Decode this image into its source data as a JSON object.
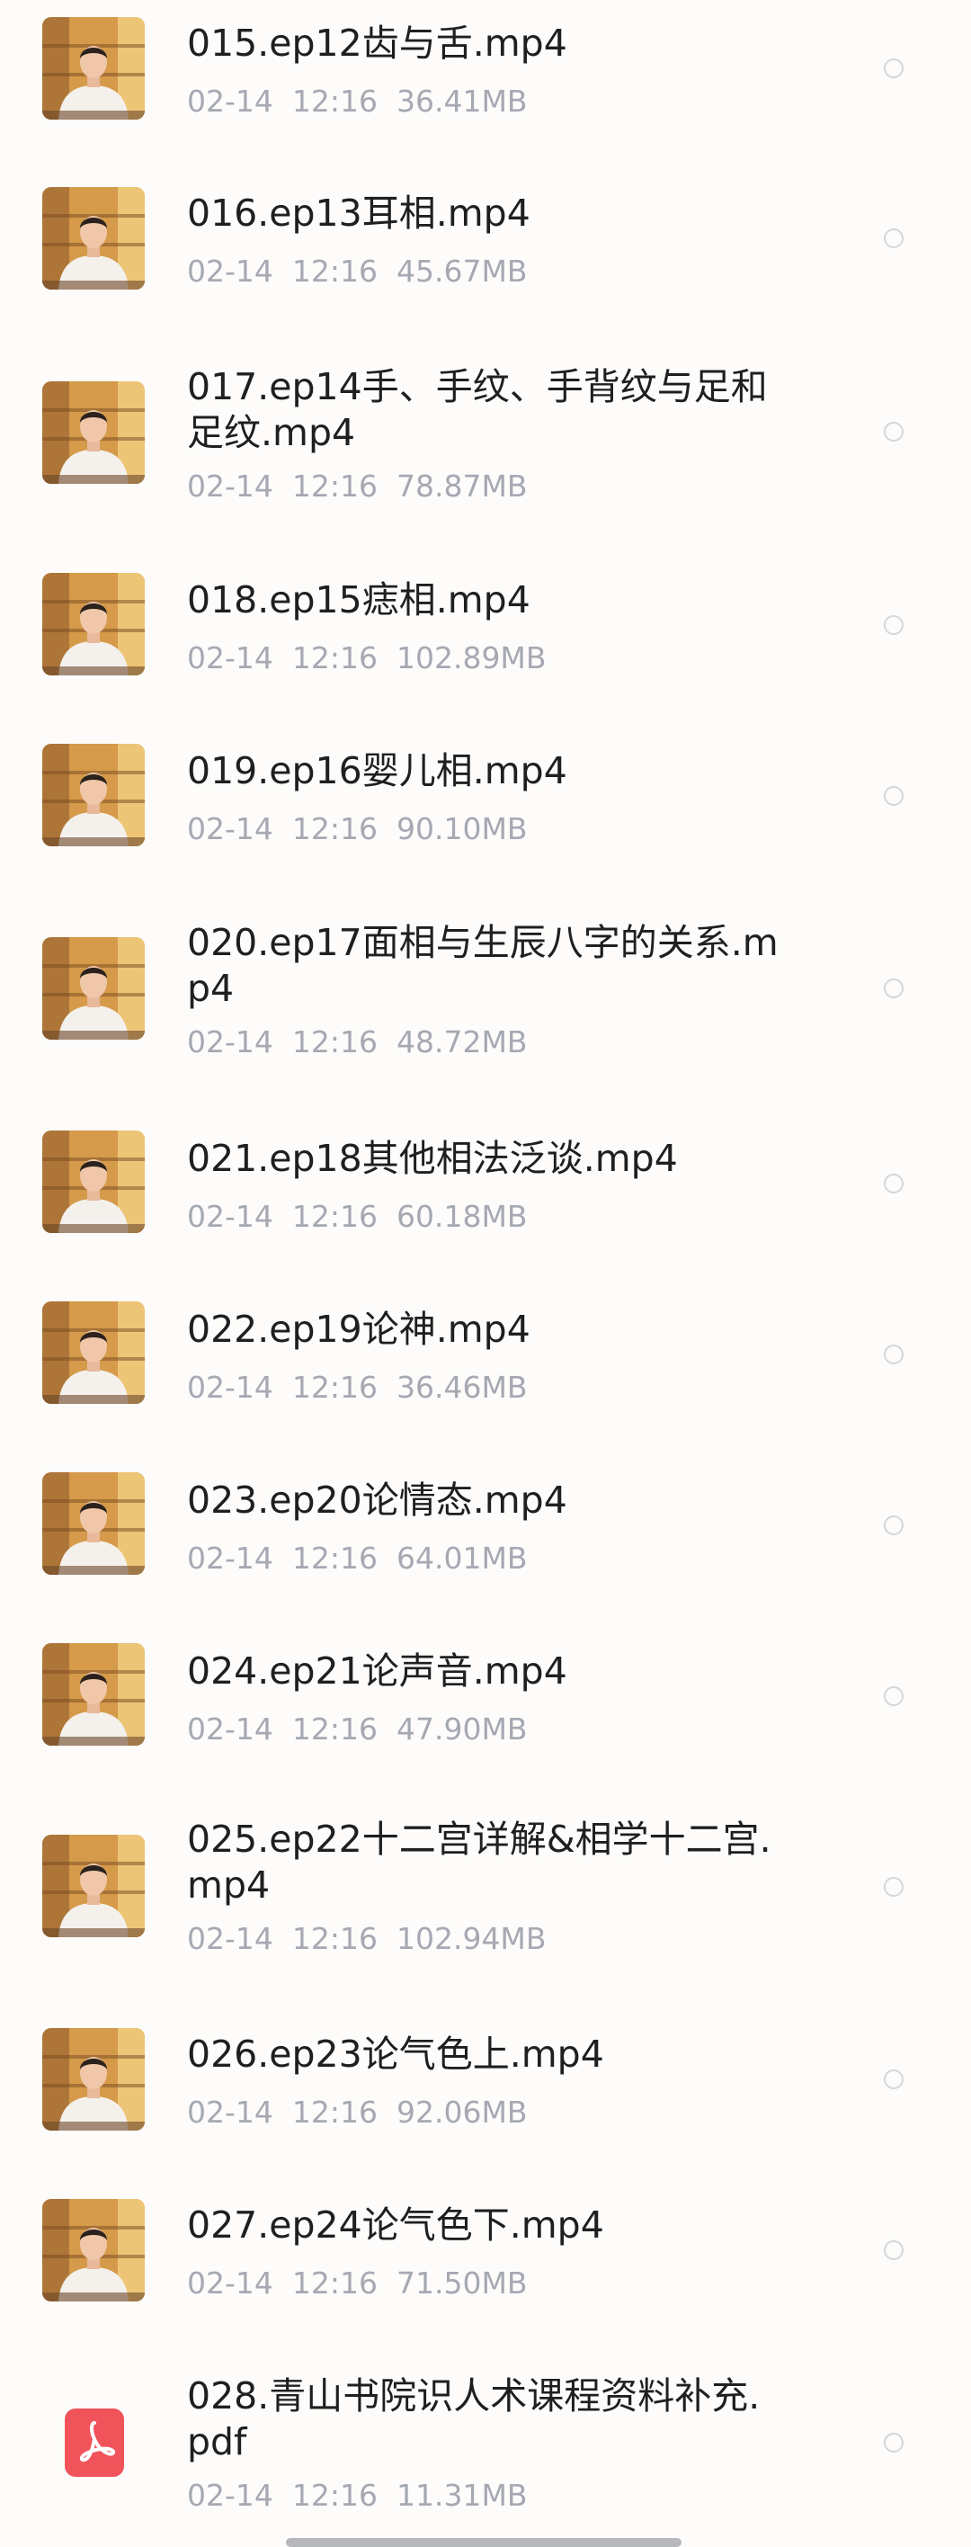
{
  "files": [
    {
      "name": "015.ep12齿与舌.mp4",
      "date": "02-14",
      "time": "12:16",
      "size": "36.41MB",
      "icon": "video-thumbnail"
    },
    {
      "name": "016.ep13耳相.mp4",
      "date": "02-14",
      "time": "12:16",
      "size": "45.67MB",
      "icon": "video-thumbnail"
    },
    {
      "name": "017.ep14手、手纹、手背纹与足和足纹.mp4",
      "date": "02-14",
      "time": "12:16",
      "size": "78.87MB",
      "icon": "video-thumbnail"
    },
    {
      "name": "018.ep15痣相.mp4",
      "date": "02-14",
      "time": "12:16",
      "size": "102.89MB",
      "icon": "video-thumbnail"
    },
    {
      "name": "019.ep16婴儿相.mp4",
      "date": "02-14",
      "time": "12:16",
      "size": "90.10MB",
      "icon": "video-thumbnail"
    },
    {
      "name": "020.ep17面相与生辰八字的关系.mp4",
      "date": "02-14",
      "time": "12:16",
      "size": "48.72MB",
      "icon": "video-thumbnail"
    },
    {
      "name": "021.ep18其他相法泛谈.mp4",
      "date": "02-14",
      "time": "12:16",
      "size": "60.18MB",
      "icon": "video-thumbnail"
    },
    {
      "name": "022.ep19论神.mp4",
      "date": "02-14",
      "time": "12:16",
      "size": "36.46MB",
      "icon": "video-thumbnail"
    },
    {
      "name": "023.ep20论情态.mp4",
      "date": "02-14",
      "time": "12:16",
      "size": "64.01MB",
      "icon": "video-thumbnail"
    },
    {
      "name": "024.ep21论声音.mp4",
      "date": "02-14",
      "time": "12:16",
      "size": "47.90MB",
      "icon": "video-thumbnail"
    },
    {
      "name": "025.ep22十二宫详解&相学十二宫.mp4",
      "date": "02-14",
      "time": "12:16",
      "size": "102.94MB",
      "icon": "video-thumbnail"
    },
    {
      "name": "026.ep23论气色上.mp4",
      "date": "02-14",
      "time": "12:16",
      "size": "92.06MB",
      "icon": "video-thumbnail"
    },
    {
      "name": "027.ep24论气色下.mp4",
      "date": "02-14",
      "time": "12:16",
      "size": "71.50MB",
      "icon": "video-thumbnail"
    },
    {
      "name": "028.青山书院识人术课程资料补充.pdf",
      "date": "02-14",
      "time": "12:16",
      "size": "11.31MB",
      "icon": "pdf-icon"
    }
  ],
  "colors": {
    "name_text": "#1f1f1f",
    "meta_text": "#a6a9b2",
    "radio_border": "#d5d6da",
    "pdf_red": "#f1535b",
    "background": "#fdfcfb"
  }
}
